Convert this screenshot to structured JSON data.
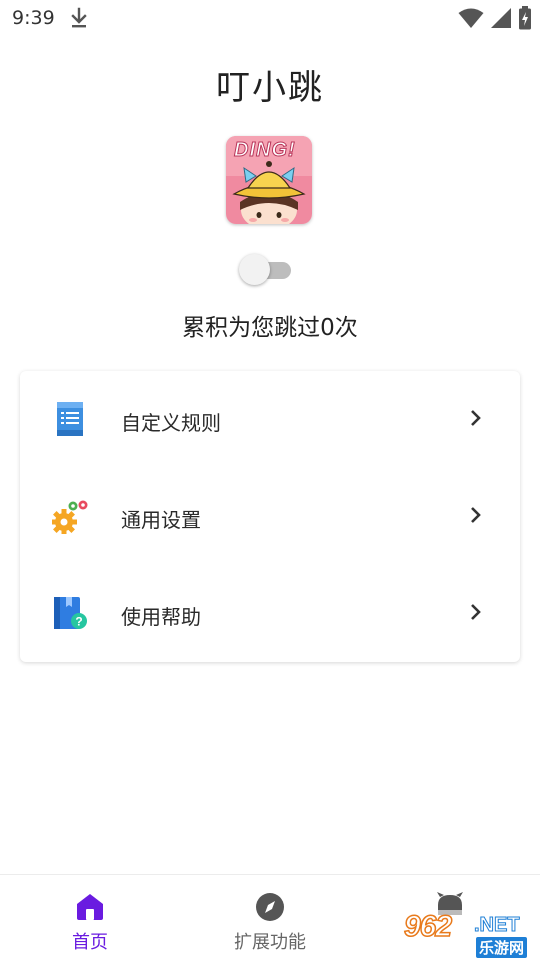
{
  "status_bar": {
    "time": "9:39",
    "icons": [
      "download-icon",
      "wifi-icon",
      "signal-icon",
      "battery-charging-icon"
    ]
  },
  "header": {
    "title": "叮小跳",
    "logo_text": "DING!"
  },
  "toggle": {
    "enabled": false
  },
  "skip_count_text": "累积为您跳过0次",
  "menu": {
    "items": [
      {
        "label": "自定义规则",
        "icon": "rules-document-icon"
      },
      {
        "label": "通用设置",
        "icon": "gears-settings-icon"
      },
      {
        "label": "使用帮助",
        "icon": "help-book-icon"
      }
    ]
  },
  "bottom_nav": {
    "items": [
      {
        "label": "首页",
        "icon": "home-icon",
        "active": true
      },
      {
        "label": "扩展功能",
        "icon": "compass-icon",
        "active": false
      },
      {
        "label": "",
        "icon": "robot-icon",
        "active": false
      }
    ]
  },
  "colors": {
    "accent": "#6a1be0",
    "text": "#222222",
    "nav_inactive": "#666666"
  },
  "watermark": {
    "brand": "962",
    "suffix": ".NET",
    "subtitle": "乐游网"
  }
}
